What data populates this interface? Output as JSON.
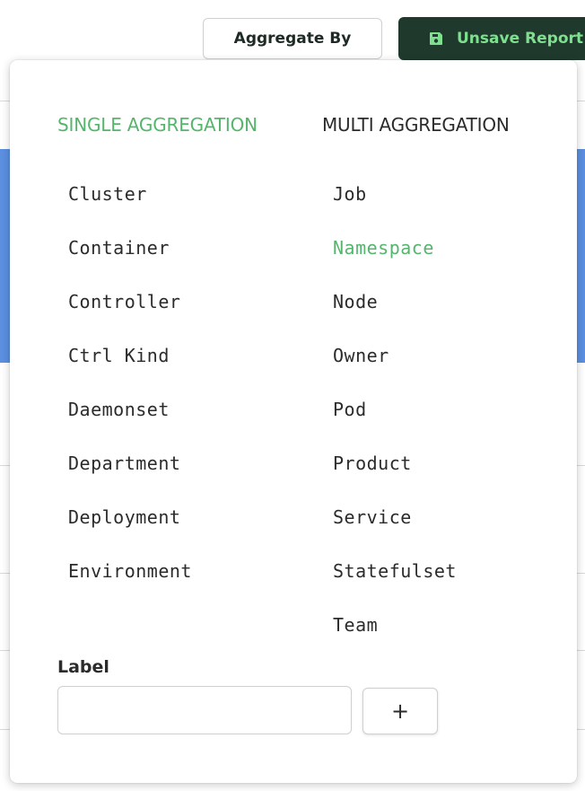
{
  "header": {
    "aggregate_button_label": "Aggregate By",
    "unsave_button_label": "Unsave Report",
    "unsave_icon": "floppy-disk-icon"
  },
  "popover": {
    "tabs": {
      "single": "SINGLE AGGREGATION",
      "multi": "MULTI AGGREGATION",
      "active": "single"
    },
    "single_options": [
      "Cluster",
      "Container",
      "Controller",
      "Ctrl Kind",
      "Daemonset",
      "Department",
      "Deployment",
      "Environment"
    ],
    "multi_options": [
      "Job",
      "Namespace",
      "Node",
      "Owner",
      "Pod",
      "Product",
      "Service",
      "Statefulset",
      "Team"
    ],
    "selected_option": "Namespace",
    "label_section": {
      "caption": "Label",
      "input_value": "",
      "add_button_label": "+"
    }
  },
  "colors": {
    "accent_green": "#55b56d",
    "dark_green": "#1f3a2d",
    "button_text_green": "#7ee08f",
    "background_blue": "#5b8fe0"
  }
}
